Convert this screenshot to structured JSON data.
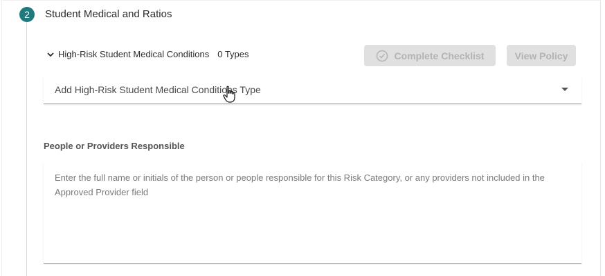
{
  "step": {
    "number": "2",
    "title": "Student Medical and Ratios"
  },
  "section": {
    "label": "High-Risk Student Medical Conditions",
    "count": "0 Types"
  },
  "buttons": {
    "complete_checklist": "Complete Checklist",
    "view_policy": "View Policy"
  },
  "select": {
    "placeholder": "Add High-Risk Student Medical Conditions Type"
  },
  "responsible": {
    "label": "People or Providers Responsible",
    "placeholder": "Enter the full name or initials of the person or people responsible for this Risk Category, or any providers not included in the Approved Provider field"
  },
  "colors": {
    "accent": "#1f7a80",
    "disabled_button_bg": "#e0e0e0",
    "disabled_button_text": "#b3b3b3"
  }
}
